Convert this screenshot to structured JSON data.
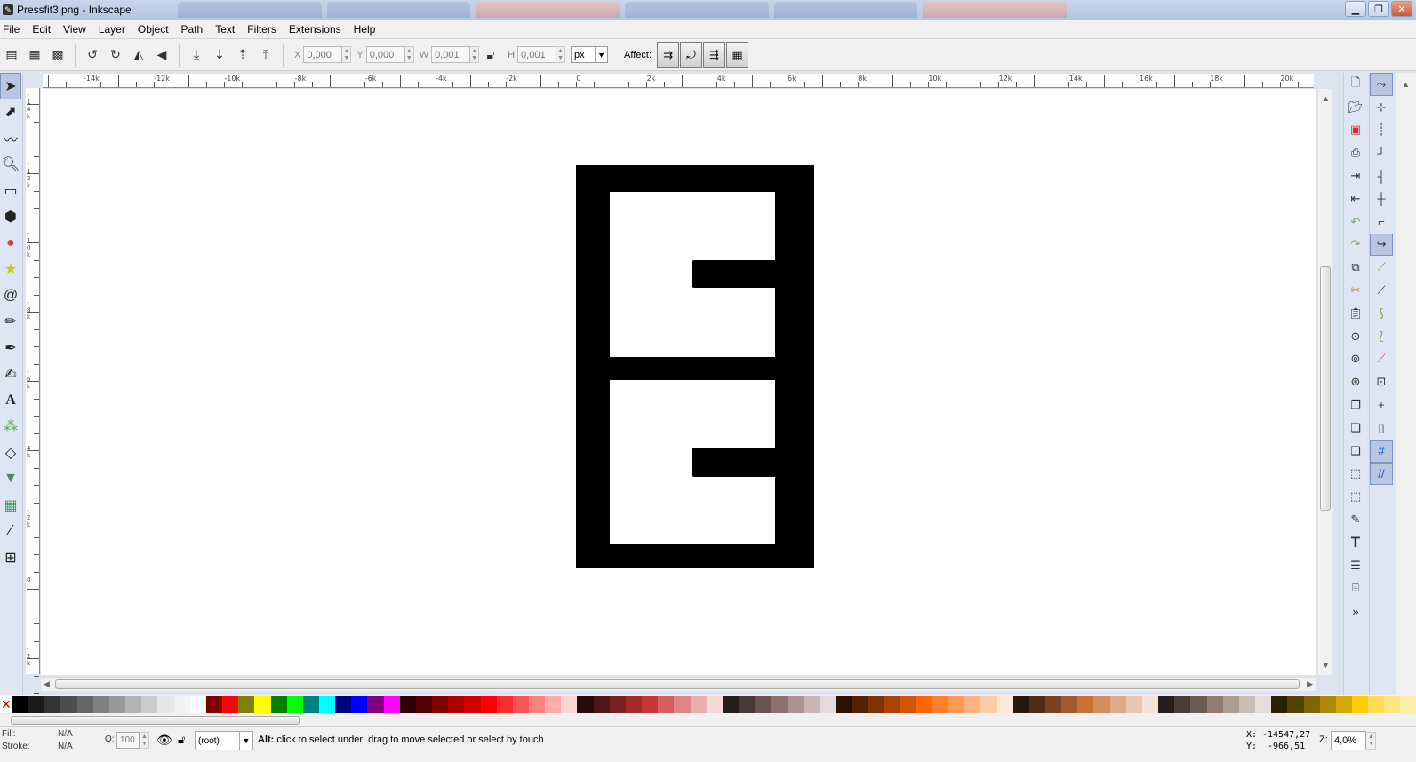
{
  "window": {
    "title": "Pressfit3.png - Inkscape",
    "buttons": {
      "minimize": "▁",
      "maximize": "❐",
      "close": "✕"
    }
  },
  "menu": [
    "File",
    "Edit",
    "View",
    "Layer",
    "Object",
    "Path",
    "Text",
    "Filters",
    "Extensions",
    "Help"
  ],
  "toolbar": {
    "x_label": "X",
    "x_value": "0,000",
    "y_label": "Y",
    "y_value": "0,000",
    "w_label": "W",
    "w_value": "0,001",
    "h_label": "H",
    "h_value": "0,001",
    "unit": "px",
    "affect_label": "Affect:"
  },
  "ruler": {
    "h_labels": [
      "-14k",
      "-12k",
      "-10k",
      "-8k",
      "-6k",
      "-4k",
      "-2k",
      "0",
      "2k",
      "4k",
      "6k",
      "8k",
      "10k",
      "12k",
      "14k",
      "16k",
      "18k",
      "20k"
    ],
    "v_labels": [
      "-14k",
      "-12k",
      "-10k",
      "-8k",
      "-6k",
      "-4k",
      "-2k",
      "0",
      "-2k"
    ]
  },
  "palette": [
    "#000000",
    "#1a1a1a",
    "#333333",
    "#4d4d4d",
    "#666666",
    "#808080",
    "#999999",
    "#b3b3b3",
    "#cccccc",
    "#e6e6e6",
    "#f2f2f2",
    "#ffffff",
    "#800000",
    "#ff0000",
    "#808000",
    "#ffff00",
    "#008000",
    "#00ff00",
    "#008080",
    "#00ffff",
    "#000080",
    "#0000ff",
    "#800080",
    "#ff00ff",
    "#2b0000",
    "#550000",
    "#800000",
    "#aa0000",
    "#d40000",
    "#ff0000",
    "#ff2a2a",
    "#ff5555",
    "#ff8080",
    "#ffaaaa",
    "#ffd5d5",
    "#280b0b",
    "#501616",
    "#782121",
    "#a02c2c",
    "#c83737",
    "#d35f5f",
    "#de8787",
    "#e9afaf",
    "#f4d7d7",
    "#241c1c",
    "#483737",
    "#6c5353",
    "#916f6f",
    "#ac9393",
    "#c8b7b7",
    "#e3dbdb",
    "#2b1100",
    "#552200",
    "#803300",
    "#aa4400",
    "#d45500",
    "#ff6600",
    "#ff7f2a",
    "#ff9955",
    "#ffb380",
    "#ffccaa",
    "#ffe6d5",
    "#28170b",
    "#502d16",
    "#784421",
    "#a05a2c",
    "#c87137",
    "#d38d5f",
    "#deaa87",
    "#e9c6af",
    "#f4e3d7",
    "#241f1c",
    "#483e37",
    "#6c5d53",
    "#917c6f",
    "#ac9d93",
    "#c8beb7",
    "#e3dedb",
    "#2b2200",
    "#554400",
    "#806600",
    "#aa8800",
    "#d4aa00",
    "#ffcc00",
    "#ffdd55",
    "#ffe680",
    "#ffeeaa"
  ],
  "status": {
    "fill_label": "Fill:",
    "fill_value": "N/A",
    "stroke_label": "Stroke:",
    "stroke_value": "N/A",
    "opacity_label": "O:",
    "opacity_value": "100",
    "layer": "(root)",
    "message_bold": "Alt:",
    "message": " click to select under; drag to move selected or select by touch",
    "x_label": "X:",
    "x_value": "-14547,27",
    "y_label": "Y:",
    "y_value": "-966,51",
    "zoom_label": "Z:",
    "zoom_value": "4,0%"
  }
}
